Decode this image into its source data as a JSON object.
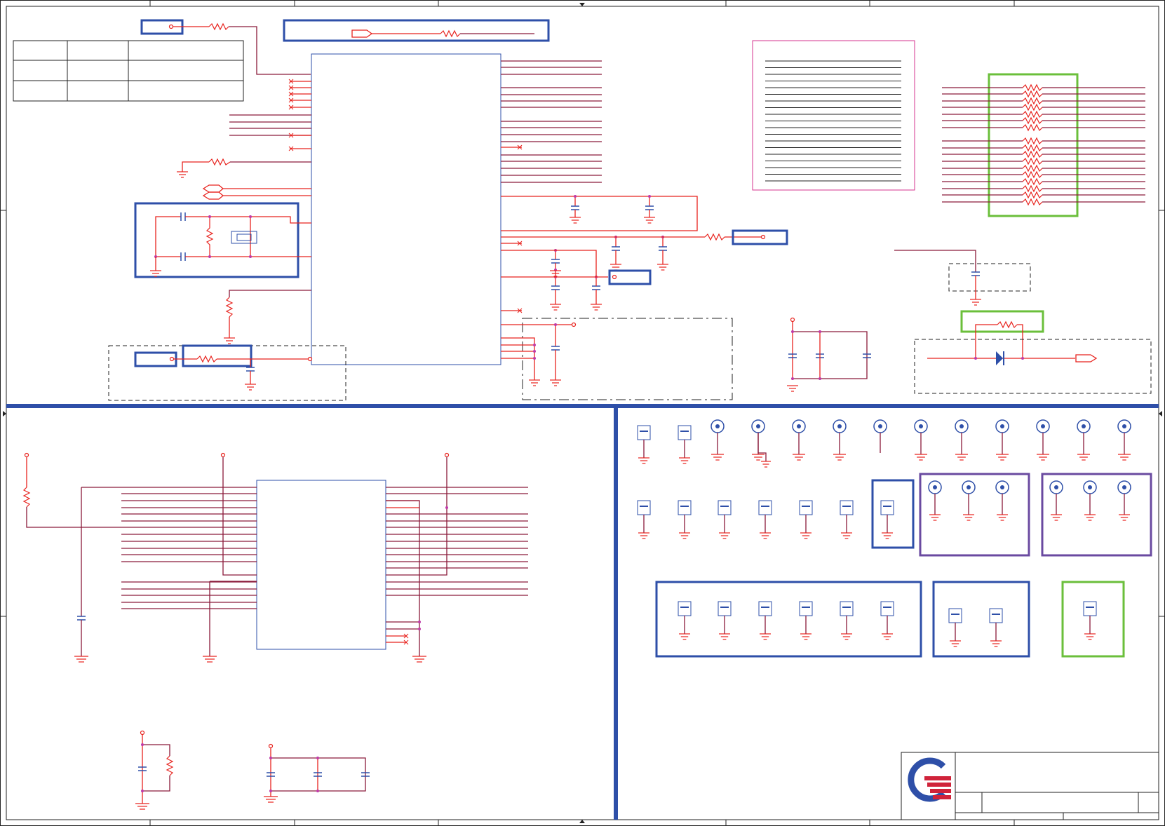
{
  "sheet": {
    "colors": {
      "wire": "#e8231e",
      "dark_wire": "#8a1a3a",
      "block_outline": "#2e4fa8",
      "highlight_green": "#6bbf3b",
      "highlight_purple": "#6a4aa0",
      "note_frame": "#d6338f",
      "logo_blue": "#2e4fa8",
      "logo_red": "#d0233a"
    },
    "icons": [
      "logo-icon",
      "resistor-icon",
      "capacitor-icon",
      "ground-icon",
      "crystal-icon",
      "diode-icon",
      "test-point-icon",
      "mounting-hole-icon"
    ]
  }
}
